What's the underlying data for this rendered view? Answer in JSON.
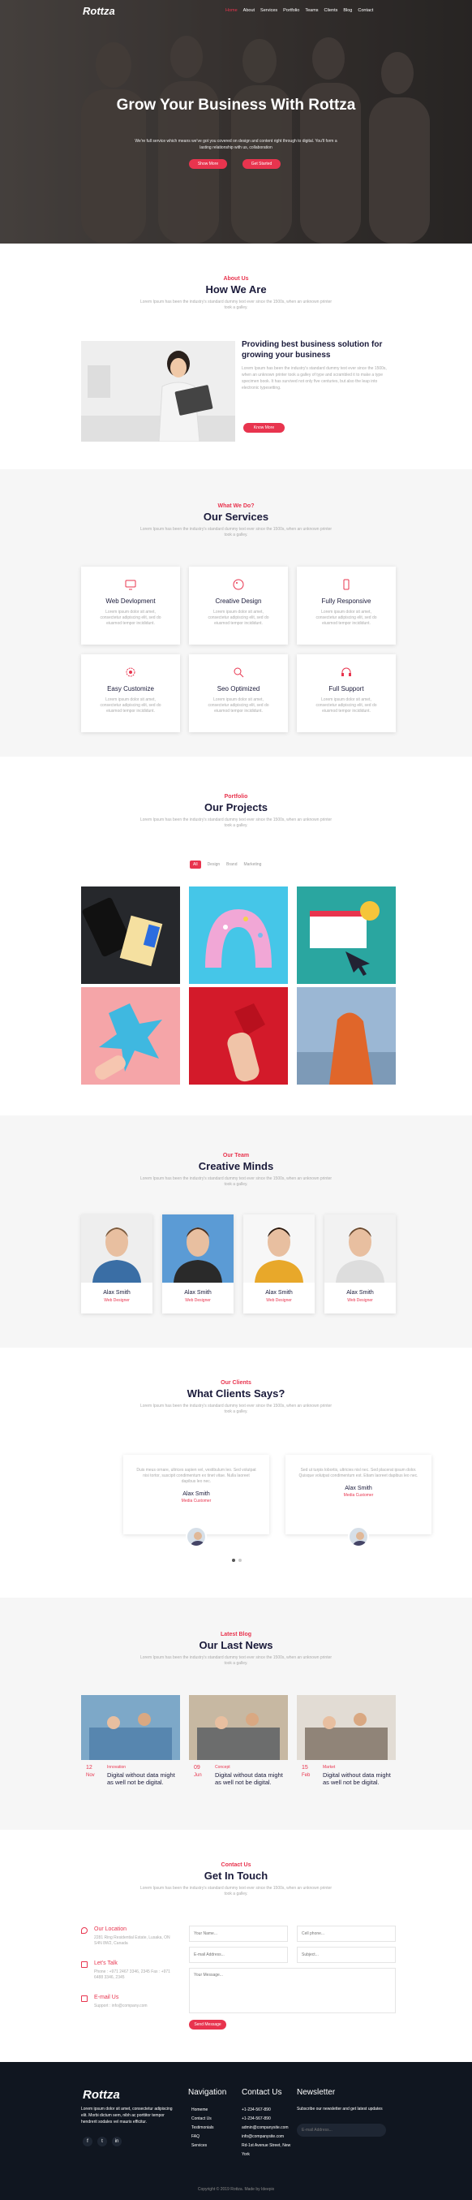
{
  "nav": {
    "logo": "Rottza",
    "links": [
      "Home",
      "About",
      "Services",
      "Portfolio",
      "Teams",
      "Clients",
      "Blog",
      "Contact"
    ]
  },
  "hero": {
    "title": "Grow Your Business With Rottza",
    "text": "We're full service which means we've got you covered on design and content right through to digital. You'll form a lasting relationship with us, collaboration",
    "btn1": "Show More",
    "btn2": "Get Started"
  },
  "about": {
    "sub": "About Us",
    "title": "How We Are",
    "desc": "Lorem Ipsum has been the industry's standard dummy text ever since the 1500s, when an unknown printer took a galley.",
    "heading": "Providing best business solution for growing your business",
    "text": "Lorem Ipsum has been the industry's standard dummy text ever since the 1500s, when an unknown printer took a galley of type and scrambled it to make a type specimen book. It has survived not only five centuries, but also the leap into electronic typesetting.",
    "btn": "Know More"
  },
  "services": {
    "sub": "What We Do?",
    "title": "Our Services",
    "desc": "Lorem Ipsum has been the industry's standard dummy text ever since the 1500s, when an unknown printer took a galley.",
    "items": [
      {
        "title": "Web Devlopment",
        "icon": "monitor-icon",
        "text": "Lorem ipsum dolor sit amet, consectetur adipiscing elit, sed do eiusmod tempor incididunt."
      },
      {
        "title": "Creative Design",
        "icon": "palette-icon",
        "text": "Lorem ipsum dolor sit amet, consectetur adipiscing elit, sed do eiusmod tempor incididunt."
      },
      {
        "title": "Fully Responsive",
        "icon": "mobile-icon",
        "text": "Lorem ipsum dolor sit amet, consectetur adipiscing elit, sed do eiusmod tempor incididunt."
      },
      {
        "title": "Easy Customize",
        "icon": "gear-icon",
        "text": "Lorem ipsum dolor sit amet, consectetur adipiscing elit, sed do eiusmod tempor incididunt."
      },
      {
        "title": "Seo Optimized",
        "icon": "search-icon",
        "text": "Lorem ipsum dolor sit amet, consectetur adipiscing elit, sed do eiusmod tempor incididunt."
      },
      {
        "title": "Full Support",
        "icon": "headset-icon",
        "text": "Lorem ipsum dolor sit amet, consectetur adipiscing elit, sed do eiusmod tempor incididunt."
      }
    ]
  },
  "portfolio": {
    "sub": "Portfolio",
    "title": "Our Projects",
    "desc": "Lorem Ipsum has been the industry's standard dummy text ever since the 1500s, when an unknown printer took a galley.",
    "filters": [
      "All",
      "Design",
      "Brand",
      "Marketing"
    ]
  },
  "team": {
    "sub": "Our Team",
    "title": "Creative Minds",
    "desc": "Lorem Ipsum has been the industry's standard dummy text ever since the 1500s, when an unknown printer took a galley.",
    "members": [
      {
        "name": "Alax Smith",
        "role": "Web Designer"
      },
      {
        "name": "Alax Smith",
        "role": "Web Designer"
      },
      {
        "name": "Alax Smith",
        "role": "Web Designer"
      },
      {
        "name": "Alax Smith",
        "role": "Web Designer"
      }
    ]
  },
  "clients": {
    "sub": "Our Clients",
    "title": "What Clients Says?",
    "desc": "Lorem Ipsum has been the industry's standard dummy text ever since the 1500s, when an unknown printer took a galley.",
    "quotes": [
      {
        "text": "Duis meus ornare, ultrices sapien vel, vestibulum leo. Sed volutpat nisi tortor, suscipit condimentum ex tinet vitae. Nulla laoreet dapibus leo nec.",
        "name": "Alax Smith",
        "role": "Media Customer"
      },
      {
        "text": "Sed ut turpis lobortis, ultricies nisl nec. Sed placerat ipsum dolor. Quisque volutpat condimentum est. Etiam laoreet dapibus leo nec.",
        "name": "Alax Smith",
        "role": "Media Customer"
      }
    ]
  },
  "blog": {
    "sub": "Latest Blog",
    "title": "Our Last News",
    "desc": "Lorem Ipsum has been the industry's standard dummy text ever since the 1500s, when an unknown printer took a galley.",
    "posts": [
      {
        "day": "12",
        "month": "Nov",
        "cat": "Innovation",
        "title": "Digital without data might as well not be digital."
      },
      {
        "day": "09",
        "month": "Jun",
        "cat": "Concept",
        "title": "Digital without data might as well not be digital."
      },
      {
        "day": "15",
        "month": "Feb",
        "cat": "Market",
        "title": "Digital without data might as well not be digital."
      }
    ]
  },
  "contact": {
    "sub": "Contact Us",
    "title": "Get In Touch",
    "desc": "Lorem Ipsum has been the industry's standard dummy text ever since the 1500s, when an unknown printer took a galley.",
    "info": [
      {
        "label": "Our Location",
        "text": "2281 Ring Residential Estate, Lusaka, ON S4N 8W2, Canada"
      },
      {
        "label": "Let's Talk",
        "text": "Phone : +971 2467 3346, 2345 Fax : +971 6488 3346, 2345"
      },
      {
        "label": "E-mail Us",
        "text": "Support : info@company.com"
      }
    ],
    "ph_name": "Your Name...",
    "ph_phone": "Cell phone...",
    "ph_email": "E-mail Address...",
    "ph_subject": "Subject...",
    "ph_message": "Your Message...",
    "btn": "Send Message"
  },
  "footer": {
    "logo": "Rottza",
    "about": "Lorem ipsum dolor sit amet, consectetur adipiscing elit. Morbi dictum sem, nibh ac porttitor tempor hendrerit sodales vel mauris efficitur.",
    "nav_title": "Navigation",
    "nav": [
      "Homeme",
      "Contact Us",
      "Testimonials",
      "FAQ",
      "Services"
    ],
    "contact_title": "Contact Us",
    "contact": [
      "+1-234-567-890",
      "+1-234-567-890",
      "admin@companysite.com",
      "info@companysite.com",
      "Rd-1st Avenue Street, New York"
    ],
    "news_title": "Newsletter",
    "news_text": "Subscribe our newsletter and get latest updates",
    "news_ph": "E-mail Address...",
    "copy": "Copyright © 2019 Rottza. Made by Ideepix"
  },
  "colors": {
    "accent": "#e8344e",
    "navy": "#1a1a3a",
    "footer": "#101620"
  }
}
